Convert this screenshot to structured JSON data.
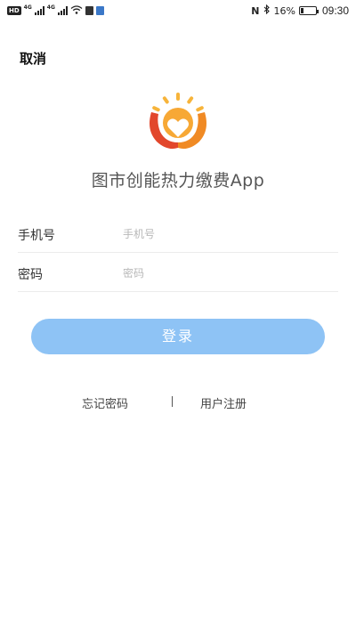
{
  "status_bar": {
    "hd_badge": "HD",
    "sim1_tag": "4G",
    "sim2_tag": "4G",
    "nfc": "N",
    "bluetooth": "∦",
    "battery_text": "16%",
    "battery_level": 0.16,
    "time": "09:30"
  },
  "header": {
    "cancel_label": "取消"
  },
  "app": {
    "title": "图市创能热力缴费App"
  },
  "form": {
    "phone_label": "手机号",
    "phone_placeholder": "手机号",
    "phone_value": "",
    "password_label": "密码",
    "password_placeholder": "密码",
    "password_value": "",
    "login_label": "登录"
  },
  "links": {
    "forgot_label": "忘记密码",
    "register_label": "用户注册"
  },
  "colors": {
    "login_button": "#8ec3f5",
    "logo_orange": "#f08a24",
    "logo_yellow": "#f7b43a",
    "logo_red": "#e2472c"
  }
}
